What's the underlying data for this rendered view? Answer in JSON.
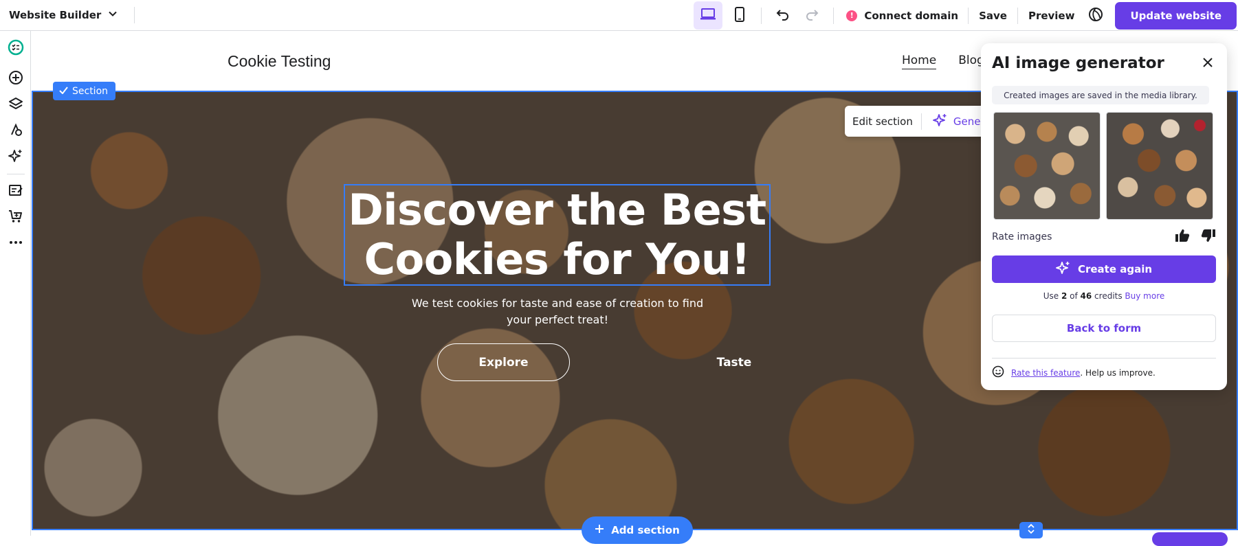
{
  "topbar": {
    "app_name": "Website Builder",
    "connect_domain": "Connect domain",
    "save": "Save",
    "preview": "Preview",
    "update_website": "Update website",
    "warning_symbol": "!"
  },
  "site": {
    "title": "Cookie Testing",
    "nav": [
      {
        "label": "Home"
      },
      {
        "label": "Blog"
      }
    ]
  },
  "hero": {
    "section_tag": "Section",
    "headline_line1": "Discover the Best",
    "headline_line2": "Cookies for You!",
    "subtext": "We test cookies for taste and ease of creation to find your perfect treat!",
    "explore": "Explore",
    "taste": "Taste"
  },
  "edit_toolbar": {
    "edit_section": "Edit section",
    "generate": "Generate"
  },
  "add_section": "Add section",
  "ai_panel": {
    "title": "AI image generator",
    "note": "Created images are saved in the media library.",
    "rate_label": "Rate images",
    "create_again": "Create again",
    "credits_prefix": "Use ",
    "credits_used": "2",
    "credits_of": " of ",
    "credits_total": "46",
    "credits_suffix": " credits ",
    "buy_more": "Buy more",
    "back_to_form": "Back to form",
    "rate_feature": "Rate this feature",
    "help_text": ". Help us improve."
  },
  "colors": {
    "accent_purple": "#673de6",
    "selection_blue": "#357df9",
    "warning_pink": "#fc5185"
  },
  "icons": [
    "chevron-down-icon",
    "desktop-icon",
    "mobile-icon",
    "undo-icon",
    "redo-icon",
    "globe-icon",
    "close-icon",
    "thumbs-up-icon",
    "thumbs-down-icon",
    "sparkle-icon",
    "smiley-icon",
    "plus-icon",
    "checkmark-icon",
    "arrows-updown-icon"
  ]
}
